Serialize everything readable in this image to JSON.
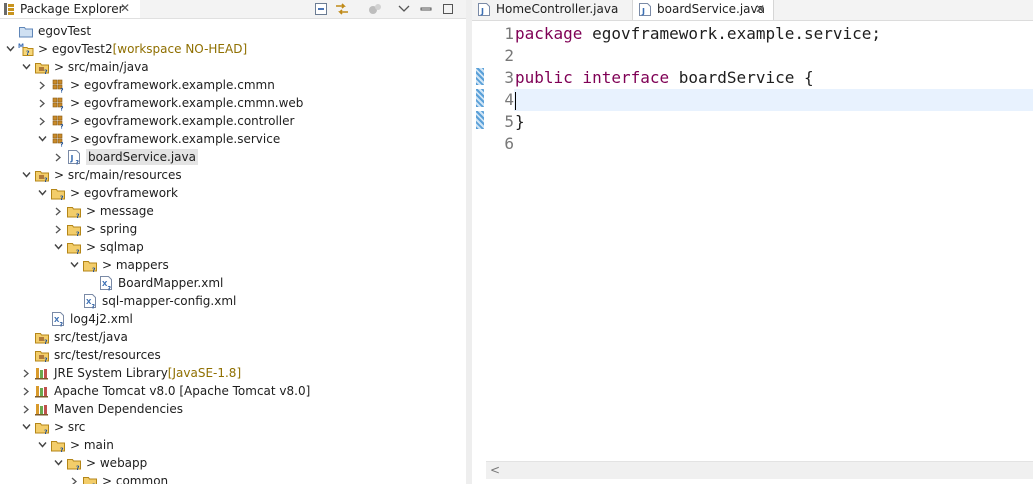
{
  "package_explorer": {
    "title": "Package Explorer",
    "tree": [
      {
        "label": "egovTest",
        "deco": "",
        "icon": "project-icon",
        "arrow": "none",
        "indent": 0
      },
      {
        "label": "> egovTest2",
        "deco": "[workspace NO-HEAD]",
        "icon": "maven-project-icon",
        "arrow": "down",
        "indent": 0
      },
      {
        "label": "> src/main/java",
        "deco": "",
        "icon": "source-folder-icon",
        "arrow": "down",
        "indent": 1
      },
      {
        "label": "> egovframework.example.cmmn",
        "deco": "",
        "icon": "package-icon",
        "arrow": "right",
        "indent": 2
      },
      {
        "label": "> egovframework.example.cmmn.web",
        "deco": "",
        "icon": "package-icon",
        "arrow": "right",
        "indent": 2
      },
      {
        "label": "> egovframework.example.controller",
        "deco": "",
        "icon": "package-icon",
        "arrow": "right",
        "indent": 2
      },
      {
        "label": "> egovframework.example.service",
        "deco": "",
        "icon": "package-icon",
        "arrow": "down",
        "indent": 2
      },
      {
        "label": "boardService.java",
        "deco": "",
        "icon": "java-file-icon",
        "arrow": "right",
        "indent": 3,
        "selected": true
      },
      {
        "label": "> src/main/resources",
        "deco": "",
        "icon": "source-folder-icon",
        "arrow": "down",
        "indent": 1
      },
      {
        "label": "> egovframework",
        "deco": "",
        "icon": "folder-icon",
        "arrow": "down",
        "indent": 2
      },
      {
        "label": "> message",
        "deco": "",
        "icon": "folder-icon",
        "arrow": "right",
        "indent": 3
      },
      {
        "label": "> spring",
        "deco": "",
        "icon": "folder-icon",
        "arrow": "right",
        "indent": 3
      },
      {
        "label": "> sqlmap",
        "deco": "",
        "icon": "folder-icon",
        "arrow": "down",
        "indent": 3
      },
      {
        "label": "> mappers",
        "deco": "",
        "icon": "folder-icon",
        "arrow": "down",
        "indent": 4
      },
      {
        "label": "BoardMapper.xml",
        "deco": "",
        "icon": "xml-file-icon",
        "arrow": "none",
        "indent": 5
      },
      {
        "label": "sql-mapper-config.xml",
        "deco": "",
        "icon": "xml-file-icon",
        "arrow": "none",
        "indent": 4
      },
      {
        "label": "log4j2.xml",
        "deco": "",
        "icon": "xml-file-icon",
        "arrow": "none",
        "indent": 2
      },
      {
        "label": "src/test/java",
        "deco": "",
        "icon": "source-folder-icon",
        "arrow": "none",
        "indent": 1
      },
      {
        "label": "src/test/resources",
        "deco": "",
        "icon": "source-folder-icon",
        "arrow": "none",
        "indent": 1
      },
      {
        "label": "JRE System Library",
        "deco": "[JavaSE-1.8]",
        "icon": "library-icon",
        "arrow": "right",
        "indent": 1
      },
      {
        "label": "Apache Tomcat v8.0 [Apache Tomcat v8.0]",
        "deco": "",
        "icon": "library-icon",
        "arrow": "right",
        "indent": 1
      },
      {
        "label": "Maven Dependencies",
        "deco": "",
        "icon": "library-icon",
        "arrow": "right",
        "indent": 1
      },
      {
        "label": "> src",
        "deco": "",
        "icon": "folder-icon",
        "arrow": "down",
        "indent": 1
      },
      {
        "label": "> main",
        "deco": "",
        "icon": "folder-icon",
        "arrow": "down",
        "indent": 2
      },
      {
        "label": "> webapp",
        "deco": "",
        "icon": "folder-icon",
        "arrow": "down",
        "indent": 3
      },
      {
        "label": "> common",
        "deco": "",
        "icon": "folder-icon",
        "arrow": "right",
        "indent": 4
      }
    ]
  },
  "editor": {
    "tabs": [
      {
        "label": "HomeController.java",
        "active": false
      },
      {
        "label": "boardService.java",
        "active": true
      }
    ],
    "line_numbers": [
      "1",
      "2",
      "3",
      "4",
      "5",
      "6"
    ],
    "code": [
      {
        "kw": "package",
        "rest": " egovframework.example.service;"
      },
      {
        "kw": "",
        "rest": ""
      },
      {
        "kw": "public interface",
        "rest": " boardService {"
      },
      {
        "kw": "",
        "rest": ""
      },
      {
        "kw": "",
        "rest": "}"
      },
      {
        "kw": "",
        "rest": ""
      }
    ],
    "current_line": 4
  }
}
